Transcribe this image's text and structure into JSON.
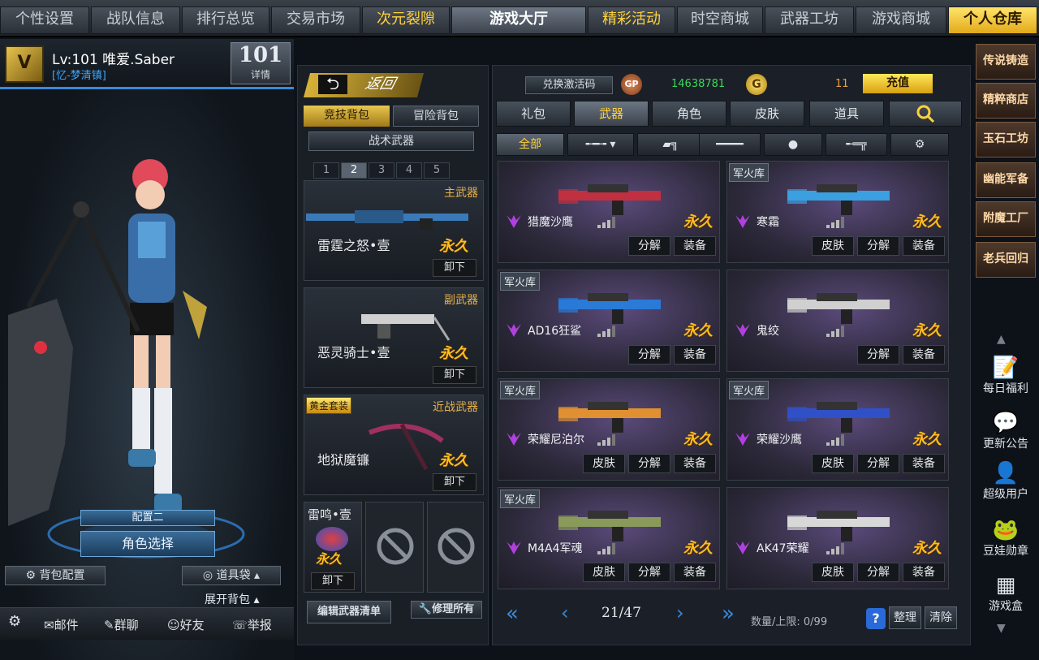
{
  "topnav": {
    "tabs": [
      {
        "label": "个性设置",
        "style": ""
      },
      {
        "label": "战队信息",
        "style": ""
      },
      {
        "label": "排行总览",
        "style": ""
      },
      {
        "label": "交易市场",
        "style": ""
      },
      {
        "label": "次元裂隙",
        "style": "gold"
      },
      {
        "label": "游戏大厅",
        "style": "active"
      },
      {
        "label": "精彩活动",
        "style": "gold"
      },
      {
        "label": "时空商城",
        "style": ""
      },
      {
        "label": "武器工坊",
        "style": ""
      },
      {
        "label": "游戏商城",
        "style": ""
      },
      {
        "label": "个人仓库",
        "style": "warehouse"
      }
    ]
  },
  "player": {
    "level_name": "Lv:101 唯爱.Saber",
    "clan": "[忆-梦清镇]",
    "rank_label": "101",
    "detail": "详情",
    "config_label": "配置二",
    "char_select": "角色选择",
    "bag_config": "背包配置",
    "item_bag": "道具袋",
    "expand_bag": "展开背包"
  },
  "bottombar": {
    "mail": "邮件",
    "group_chat": "群聊",
    "friends": "好友",
    "report": "举报"
  },
  "midpanel": {
    "back": "返回",
    "bag_tabs": [
      "竞技背包",
      "冒险背包"
    ],
    "tactical": "战术武器",
    "pages": [
      "1",
      "2",
      "3",
      "4",
      "5"
    ],
    "active_page": "2",
    "slots": [
      {
        "category": "主武器",
        "name": "雷霆之怒•壹",
        "status": "永久",
        "action": "卸下"
      },
      {
        "category": "副武器",
        "name": "恶灵骑士•壹",
        "status": "永久",
        "action": "卸下"
      },
      {
        "category": "近战武器",
        "name": "地狱魔镰",
        "status": "永久",
        "action": "卸下",
        "tag": "黄金套装"
      }
    ],
    "grenade": {
      "name": "雷鸣•壹",
      "status": "永久",
      "action": "卸下"
    },
    "edit_list": "编辑武器清单",
    "repair_all": "修理所有"
  },
  "rightpanel": {
    "redeem": "兑换激活码",
    "gp_amount": "14638781",
    "coin_amount": "11",
    "recharge": "充值",
    "categories": [
      "礼包",
      "武器",
      "角色",
      "皮肤",
      "道具"
    ],
    "active_category": "武器",
    "sub_all": "全部",
    "items": [
      {
        "name": "猎魔沙鹰",
        "arsenal": "",
        "status": "永久",
        "actions": [
          "分解",
          "装备"
        ],
        "color": "#c03040"
      },
      {
        "name": "寒霜",
        "arsenal": "军火库",
        "status": "永久",
        "actions": [
          "皮肤",
          "分解",
          "装备"
        ],
        "color": "#3aa0e0"
      },
      {
        "name": "AD16狂鲨",
        "arsenal": "军火库",
        "status": "永久",
        "actions": [
          "分解",
          "装备"
        ],
        "color": "#2a7ad8"
      },
      {
        "name": "鬼绞",
        "arsenal": "",
        "status": "永久",
        "actions": [
          "分解",
          "装备"
        ],
        "color": "#d0d0d0"
      },
      {
        "name": "荣耀尼泊尔",
        "arsenal": "军火库",
        "status": "永久",
        "actions": [
          "皮肤",
          "分解",
          "装备"
        ],
        "color": "#e09030"
      },
      {
        "name": "荣耀沙鹰",
        "arsenal": "军火库",
        "status": "永久",
        "actions": [
          "皮肤",
          "分解",
          "装备"
        ],
        "color": "#3050c8"
      },
      {
        "name": "M4A4军魂",
        "arsenal": "军火库",
        "status": "永久",
        "actions": [
          "皮肤",
          "分解",
          "装备"
        ],
        "color": "#8a9a5a"
      },
      {
        "name": "AK47荣耀",
        "arsenal": "",
        "status": "永久",
        "actions": [
          "皮肤",
          "分解",
          "装备"
        ],
        "color": "#d8d8d8"
      }
    ],
    "page": "21/47",
    "capacity": "数量/上限: 0/99",
    "sort": "整理",
    "clear": "清除"
  },
  "sidebar": {
    "buttons": [
      "传说铸造",
      "精粹商店",
      "玉石工坊",
      "幽能军备",
      "附魔工厂",
      "老兵回归"
    ],
    "icons": [
      {
        "label": "每日福利",
        "icon": "calendar-icon"
      },
      {
        "label": "更新公告",
        "icon": "message-icon"
      },
      {
        "label": "超级用户",
        "icon": "user-search-icon"
      },
      {
        "label": "豆娃勋章",
        "icon": "medal-icon"
      },
      {
        "label": "游戏盒",
        "icon": "box-icon"
      }
    ]
  }
}
